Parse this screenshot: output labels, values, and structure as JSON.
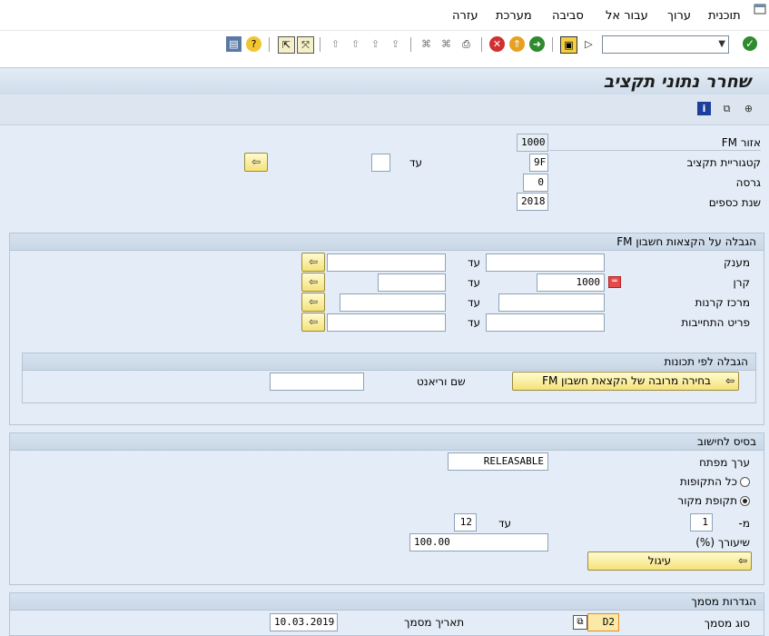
{
  "menu": {
    "items": [
      "תוכנית",
      "ערוך",
      "עבור אל",
      "סביבה",
      "מערכת",
      "עזרה"
    ]
  },
  "toolbar": {
    "command_field_value": "",
    "enter_icon": "check-icon",
    "icons": [
      "layout-icon",
      "help-icon",
      "maximize-icon",
      "minimize-icon",
      "create-session-icon",
      "shortcut-icon",
      "page-last-icon",
      "page-next-icon",
      "page-prev-icon",
      "page-first-icon",
      "find-next-icon",
      "find-icon",
      "print-icon",
      "cancel-icon",
      "exit-icon",
      "back-icon",
      "save-icon"
    ]
  },
  "title": "שחרר נתוני תקציב",
  "app_toolbar": {
    "icons": [
      "info-icon",
      "copy-icon",
      "execute-icon"
    ]
  },
  "header": {
    "fm_area": {
      "label": "אזור FM",
      "value": "1000"
    },
    "budget_category": {
      "label": "קטגוריית תקציב",
      "value": "9F",
      "to_label": "עד",
      "to_value": ""
    },
    "version": {
      "label": "גרסה",
      "value": "0"
    },
    "fiscal_year": {
      "label": "שנת כספים",
      "value": "2018"
    }
  },
  "restriction": {
    "title": "הגבלה על הקצאות חשבון FM",
    "rows": [
      {
        "label": "מענק",
        "from": "",
        "to_label": "עד",
        "to": ""
      },
      {
        "label": "קרן",
        "from": "1000",
        "to_label": "עד",
        "to": ""
      },
      {
        "label": "מרכז קרנות",
        "from": "",
        "to_label": "עד",
        "to": ""
      },
      {
        "label": "פריט התחייבות",
        "from": "",
        "to_label": "עד",
        "to": ""
      }
    ],
    "attributes": {
      "title": "הגבלה לפי תכונות",
      "button": "בחירה מרובה של הקצאת חשבון FM",
      "variant_label": "שם וריאנט",
      "variant_value": ""
    }
  },
  "basis": {
    "title": "בסיס לחישוב",
    "key_value_label": "ערך מפתח",
    "key_value": "RELEASABLE",
    "all_periods": "כל התקופות",
    "source_period": "תקופת מקור",
    "selected": "source_period",
    "from_label": "מ-",
    "from_value": "1",
    "to_label": "עד",
    "to_value": "12",
    "percentage_label": "שיעורך (%)",
    "percentage_value": "100.00",
    "rounding_button": "עיגול"
  },
  "doc_settings": {
    "title": "הגדרות מסמך",
    "doc_type_label": "סוג מסמך",
    "doc_type_value": "D2",
    "doc_date_label": "תאריך מסמך",
    "doc_date_value": "10.03.2019"
  }
}
